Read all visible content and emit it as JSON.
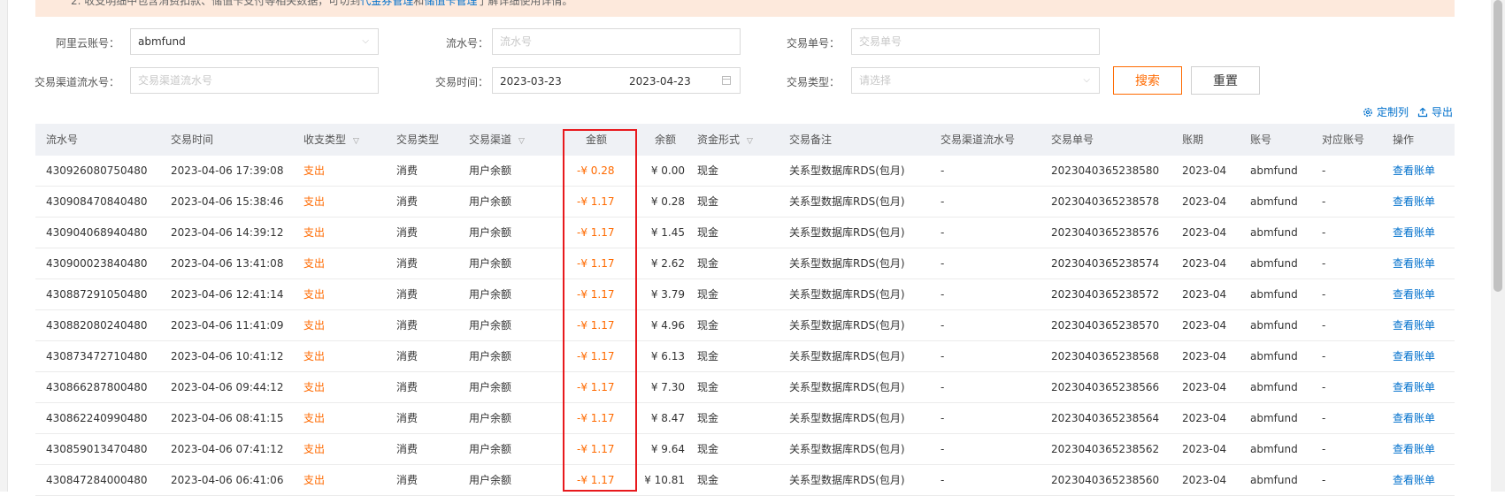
{
  "notice": {
    "text": "2. 收支明细中包含消费扣款、储值卡支付等相关数据，可切到",
    "link1": "代金券管理",
    "mid": "和",
    "link2": "储值卡管理",
    "suffix": "了解详细使用详情。"
  },
  "filters": {
    "account_label": "阿里云账号：",
    "account_value": "abmfund",
    "serial_label": "流水号：",
    "serial_placeholder": "流水号",
    "order_label": "交易单号：",
    "order_placeholder": "交易单号",
    "channel_label": "交易渠道流水号：",
    "channel_placeholder": "交易渠道流水号",
    "time_label": "交易时间：",
    "time_start": "2023-03-23",
    "time_end": "2023-04-23",
    "type_label": "交易类型：",
    "type_placeholder": "请选择"
  },
  "buttons": {
    "search": "搜索",
    "reset": "重置"
  },
  "toolbar": {
    "customize": "定制列",
    "export": "导出"
  },
  "table": {
    "headers": {
      "serial": "流水号",
      "time": "交易时间",
      "io_type": "收支类型",
      "trade_type": "交易类型",
      "channel": "交易渠道",
      "amount": "金额",
      "balance": "余额",
      "fund_form": "资金形式",
      "remark": "交易备注",
      "channel_serial": "交易渠道流水号",
      "order_no": "交易单号",
      "period": "账期",
      "account": "账号",
      "counter_account": "对应账号",
      "action": "操作"
    },
    "rows": [
      {
        "serial": "430926080750480",
        "time": "2023-04-06 17:39:08",
        "io": "支出",
        "trade": "消费",
        "channel": "用户余额",
        "amount": "-¥ 0.28",
        "balance": "¥ 0.00",
        "form": "现金",
        "remark": "关系型数据库RDS(包月)",
        "cserial": "-",
        "order": "2023040365238580",
        "period": "2023-04",
        "account": "abmfund",
        "counter": "-",
        "action": "查看账单"
      },
      {
        "serial": "430908470840480",
        "time": "2023-04-06 15:38:46",
        "io": "支出",
        "trade": "消费",
        "channel": "用户余额",
        "amount": "-¥ 1.17",
        "balance": "¥ 0.28",
        "form": "现金",
        "remark": "关系型数据库RDS(包月)",
        "cserial": "-",
        "order": "2023040365238578",
        "period": "2023-04",
        "account": "abmfund",
        "counter": "-",
        "action": "查看账单"
      },
      {
        "serial": "430904068940480",
        "time": "2023-04-06 14:39:12",
        "io": "支出",
        "trade": "消费",
        "channel": "用户余额",
        "amount": "-¥ 1.17",
        "balance": "¥ 1.45",
        "form": "现金",
        "remark": "关系型数据库RDS(包月)",
        "cserial": "-",
        "order": "2023040365238576",
        "period": "2023-04",
        "account": "abmfund",
        "counter": "-",
        "action": "查看账单"
      },
      {
        "serial": "430900023840480",
        "time": "2023-04-06 13:41:08",
        "io": "支出",
        "trade": "消费",
        "channel": "用户余额",
        "amount": "-¥ 1.17",
        "balance": "¥ 2.62",
        "form": "现金",
        "remark": "关系型数据库RDS(包月)",
        "cserial": "-",
        "order": "2023040365238574",
        "period": "2023-04",
        "account": "abmfund",
        "counter": "-",
        "action": "查看账单"
      },
      {
        "serial": "430887291050480",
        "time": "2023-04-06 12:41:14",
        "io": "支出",
        "trade": "消费",
        "channel": "用户余额",
        "amount": "-¥ 1.17",
        "balance": "¥ 3.79",
        "form": "现金",
        "remark": "关系型数据库RDS(包月)",
        "cserial": "-",
        "order": "2023040365238572",
        "period": "2023-04",
        "account": "abmfund",
        "counter": "-",
        "action": "查看账单"
      },
      {
        "serial": "430882080240480",
        "time": "2023-04-06 11:41:09",
        "io": "支出",
        "trade": "消费",
        "channel": "用户余额",
        "amount": "-¥ 1.17",
        "balance": "¥ 4.96",
        "form": "现金",
        "remark": "关系型数据库RDS(包月)",
        "cserial": "-",
        "order": "2023040365238570",
        "period": "2023-04",
        "account": "abmfund",
        "counter": "-",
        "action": "查看账单"
      },
      {
        "serial": "430873472710480",
        "time": "2023-04-06 10:41:12",
        "io": "支出",
        "trade": "消费",
        "channel": "用户余额",
        "amount": "-¥ 1.17",
        "balance": "¥ 6.13",
        "form": "现金",
        "remark": "关系型数据库RDS(包月)",
        "cserial": "-",
        "order": "2023040365238568",
        "period": "2023-04",
        "account": "abmfund",
        "counter": "-",
        "action": "查看账单"
      },
      {
        "serial": "430866287800480",
        "time": "2023-04-06 09:44:12",
        "io": "支出",
        "trade": "消费",
        "channel": "用户余额",
        "amount": "-¥ 1.17",
        "balance": "¥ 7.30",
        "form": "现金",
        "remark": "关系型数据库RDS(包月)",
        "cserial": "-",
        "order": "2023040365238566",
        "period": "2023-04",
        "account": "abmfund",
        "counter": "-",
        "action": "查看账单"
      },
      {
        "serial": "430862240990480",
        "time": "2023-04-06 08:41:15",
        "io": "支出",
        "trade": "消费",
        "channel": "用户余额",
        "amount": "-¥ 1.17",
        "balance": "¥ 8.47",
        "form": "现金",
        "remark": "关系型数据库RDS(包月)",
        "cserial": "-",
        "order": "2023040365238564",
        "period": "2023-04",
        "account": "abmfund",
        "counter": "-",
        "action": "查看账单"
      },
      {
        "serial": "430859013470480",
        "time": "2023-04-06 07:41:12",
        "io": "支出",
        "trade": "消费",
        "channel": "用户余额",
        "amount": "-¥ 1.17",
        "balance": "¥ 9.64",
        "form": "现金",
        "remark": "关系型数据库RDS(包月)",
        "cserial": "-",
        "order": "2023040365238562",
        "period": "2023-04",
        "account": "abmfund",
        "counter": "-",
        "action": "查看账单"
      },
      {
        "serial": "430847284000480",
        "time": "2023-04-06 06:41:06",
        "io": "支出",
        "trade": "消费",
        "channel": "用户余额",
        "amount": "-¥ 1.17",
        "balance": "¥ 10.81",
        "form": "现金",
        "remark": "关系型数据库RDS(包月)",
        "cserial": "-",
        "order": "2023040365238560",
        "period": "2023-04",
        "account": "abmfund",
        "counter": "-",
        "action": "查看账单"
      }
    ]
  },
  "colors": {
    "accent": "#ff6a00",
    "link": "#0070cc",
    "highlight": "#e8191d",
    "header_bg": "#eff1f5",
    "notice_bg": "#fde9dc"
  }
}
